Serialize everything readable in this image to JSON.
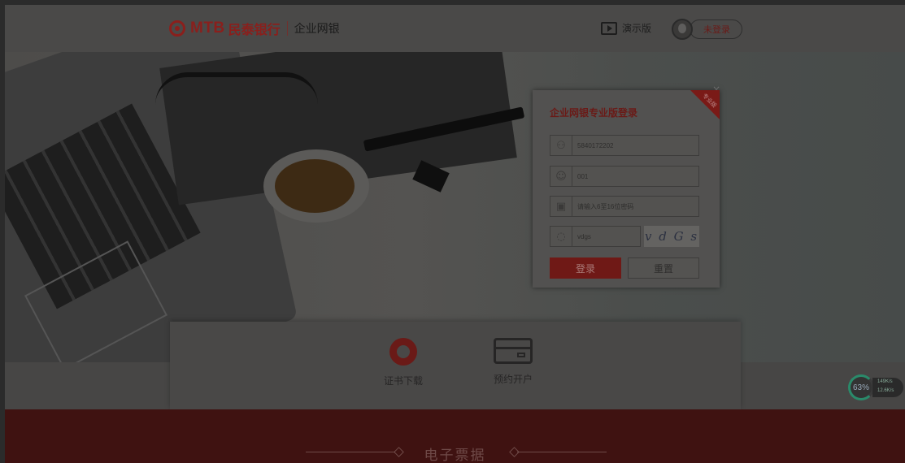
{
  "header": {
    "logo_en": "MTB",
    "logo_cn": "民泰银行",
    "logo_sub": "企业网银",
    "demo_label": "演示版",
    "login_status": "未登录"
  },
  "login": {
    "title": "企业网银专业版登录",
    "ribbon": "专业版",
    "close": "×",
    "account_value": "5840172202",
    "operator_value": "001",
    "password_placeholder": "请输入6至16位密码",
    "captcha_value": "vdgs",
    "captcha_image_text": "v d G s",
    "login_button": "登录",
    "reset_button": "重置"
  },
  "services": [
    {
      "label": "证书下载",
      "icon": "certificate-badge-icon"
    },
    {
      "label": "预约开户",
      "icon": "bank-card-icon"
    }
  ],
  "speed_widget": {
    "percent": "63%",
    "up": "149K/s",
    "down": "12.6K/s"
  },
  "band": {
    "title": "电子票据"
  },
  "colors": {
    "brand_red": "#8a1f1c",
    "overlay": "#4a4846"
  }
}
